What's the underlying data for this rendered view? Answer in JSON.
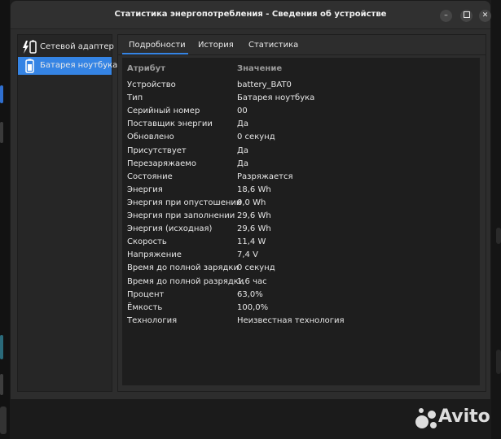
{
  "window": {
    "title": "Статистика энергопотребления - Сведения об устройстве",
    "controls": [
      "minimize",
      "maximize",
      "close"
    ]
  },
  "sidebar": {
    "items": [
      {
        "label": "Сетевой адаптер",
        "icon": "ac-adapter-icon",
        "selected": false
      },
      {
        "label": "Батарея ноутбука",
        "icon": "battery-icon",
        "selected": true
      }
    ]
  },
  "tabs": [
    {
      "label": "Подробности",
      "active": true
    },
    {
      "label": "История",
      "active": false
    },
    {
      "label": "Статистика",
      "active": false
    }
  ],
  "table": {
    "headers": {
      "attribute": "Атрибут",
      "value": "Значение"
    },
    "rows": [
      {
        "attr": "Устройство",
        "value": "battery_BAT0"
      },
      {
        "attr": "Тип",
        "value": "Батарея ноутбука"
      },
      {
        "attr": "Серийный номер",
        "value": "00"
      },
      {
        "attr": "Поставщик энергии",
        "value": "Да"
      },
      {
        "attr": "Обновлено",
        "value": "0 секунд"
      },
      {
        "attr": "Присутствует",
        "value": "Да"
      },
      {
        "attr": "Перезаряжаемо",
        "value": "Да"
      },
      {
        "attr": "Состояние",
        "value": "Разряжается"
      },
      {
        "attr": "Энергия",
        "value": "18,6 Wh"
      },
      {
        "attr": "Энергия при опустошении",
        "value": "0,0 Wh"
      },
      {
        "attr": "Энергия при заполнении",
        "value": "29,6 Wh"
      },
      {
        "attr": "Энергия (исходная)",
        "value": "29,6 Wh"
      },
      {
        "attr": "Скорость",
        "value": "11,4 W"
      },
      {
        "attr": "Напряжение",
        "value": "7,4 V"
      },
      {
        "attr": "Время до полной зарядки",
        "value": "0 секунд"
      },
      {
        "attr": "Время до полной разрядки",
        "value": "1,6 час"
      },
      {
        "attr": "Процент",
        "value": "63,0%"
      },
      {
        "attr": "Ёмкость",
        "value": "100,0%"
      },
      {
        "attr": "Технология",
        "value": "Неизвестная технология"
      }
    ]
  },
  "watermark": {
    "text": "Avito"
  },
  "colors": {
    "accent": "#3584e4",
    "window_bg": "#2d2d2d",
    "table_bg": "#1e1e1e"
  }
}
